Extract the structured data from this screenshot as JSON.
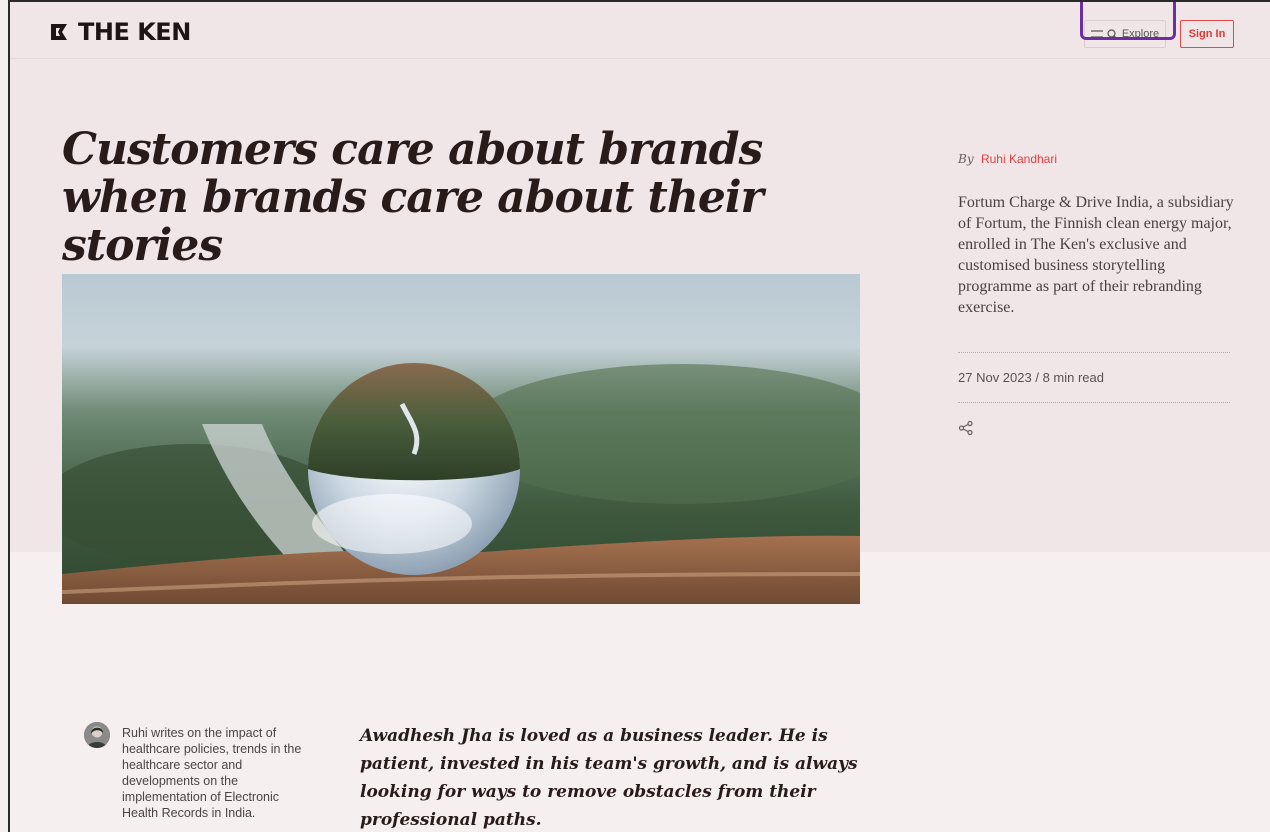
{
  "header": {
    "logo_text": "THE KEN",
    "explore_label": "Explore",
    "signin_label": "Sign In"
  },
  "article": {
    "title": "Customers care about brands when brands care about their stories",
    "by_label": "By",
    "author": "Ruhi Kandhari",
    "summary": "Fortum Charge & Drive India, a subsidiary of Fortum, the Finnish clean energy major, enrolled in The Ken's exclusive and customised business storytelling programme as part of their rebranding exercise.",
    "date": "27 Nov 2023",
    "separator": " / ",
    "read_time": "8 min read",
    "lede": "Awadhesh Jha is loved as a business leader. He is patient, invested in his team's growth, and is always looking for ways to remove obstacles from their professional paths."
  },
  "author_bio": {
    "text": "Ruhi writes on the impact of healthcare policies, trends in the healthcare sector and developments on the implementation of Electronic Health Records in India."
  },
  "icons": {
    "menu": "menu-icon",
    "search": "search-icon",
    "share": "share-icon"
  },
  "colors": {
    "accent": "#e0403f",
    "highlight": "#6b2fa3",
    "background_upper": "#f1e6e7",
    "background_lower": "#f6efef"
  }
}
